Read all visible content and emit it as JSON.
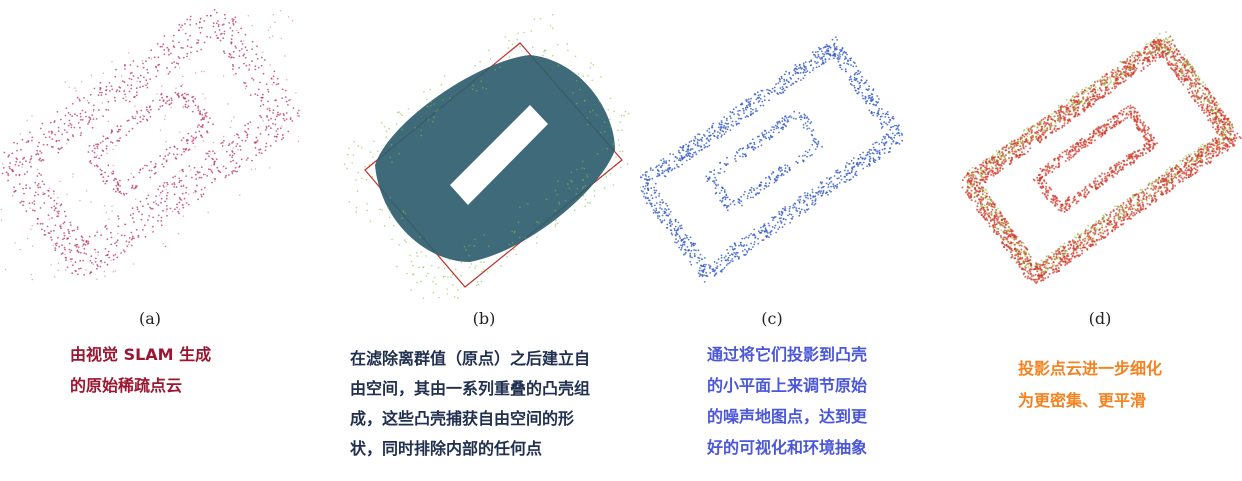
{
  "panels": [
    {
      "label": "(a)",
      "caption": [
        "由视觉 SLAM 生成",
        "的原始稀疏点云"
      ],
      "caption_color": "#9b1631",
      "point_color": "#b8355f"
    },
    {
      "label": "(b)",
      "caption": [
        "在滤除离群值（原点）之后建立自",
        "由空间，其由一系列重叠的凸壳组",
        "成，这些凸壳捕获自由空间的形",
        "状，同时排除内部的任何点"
      ],
      "caption_color": "#22304f",
      "fill_color": "#2f5d6e",
      "box_color": "#c0302b"
    },
    {
      "label": "(c)",
      "caption": [
        "通过将它们投影到凸壳",
        "的小平面上来调节原始",
        "的噪声地图点，达到更",
        "好的可视化和环境抽象"
      ],
      "caption_color": "#4b57d9",
      "point_color": "#3a5fc9"
    },
    {
      "label": "(d)",
      "caption": [
        "投影点云进一步细化",
        "为更密集、更平滑"
      ],
      "caption_color": "#f5821f",
      "point_color": "#d23a2a",
      "highlight_color": "#8cc63f"
    }
  ]
}
